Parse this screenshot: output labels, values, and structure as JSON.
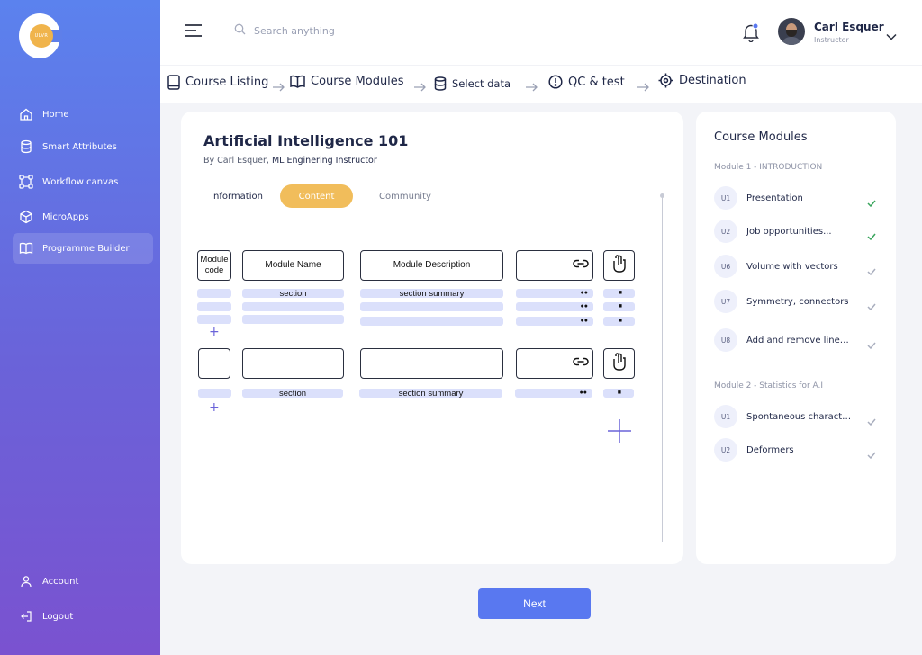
{
  "brand": {
    "logo_text": "ULVR"
  },
  "sidebar": {
    "items": [
      {
        "label": "Home",
        "icon": "home-icon"
      },
      {
        "label": "Smart Attributes",
        "icon": "database-icon"
      },
      {
        "label": "Workflow canvas",
        "icon": "workflow-icon"
      },
      {
        "label": "MicroApps",
        "icon": "cube-icon"
      },
      {
        "label": "Programme Builder",
        "icon": "book-icon",
        "active": true
      }
    ],
    "bottom": [
      {
        "label": "Account",
        "icon": "user-icon"
      },
      {
        "label": "Logout",
        "icon": "logout-icon"
      }
    ]
  },
  "header": {
    "search_placeholder": "Search anything",
    "user": {
      "name": "Carl Esquer",
      "role": "Instructor"
    },
    "notification_color": "#5978f0"
  },
  "steps": [
    {
      "label": "Course Listing",
      "icon": "tablet-icon"
    },
    {
      "label": "Course Modules",
      "icon": "open-book-icon"
    },
    {
      "label": "Select data",
      "icon": "database-icon"
    },
    {
      "label": "QC & test",
      "icon": "alert-circle-icon"
    },
    {
      "label": "Destination",
      "icon": "target-icon"
    }
  ],
  "course": {
    "title": "Artificial Intelligence 101",
    "by_prefix": "By Carl Esquer,",
    "by_role": "ML Enginering Instructor",
    "tabs": [
      {
        "label": "Information",
        "active": false
      },
      {
        "label": "Content",
        "active": true
      },
      {
        "label": "Community",
        "active": false
      }
    ]
  },
  "builder": {
    "columns": {
      "code": "Module code",
      "name": "Module Name",
      "description": "Module Description"
    },
    "section_label": "section",
    "summary_label": "section summary",
    "add_symbol": "+"
  },
  "modules_panel": {
    "title": "Course Modules",
    "modules": [
      {
        "heading": "Module 1 - INTRODUCTION",
        "lessons": [
          {
            "code": "U1",
            "title": "Presentation",
            "status": "done"
          },
          {
            "code": "U2",
            "title": "Job opportunities...",
            "status": "done"
          },
          {
            "code": "U6",
            "title": "Volume with vectors",
            "status": "pending"
          },
          {
            "code": "U7",
            "title": "Symmetry, connectors",
            "status": "pending"
          },
          {
            "code": "U8",
            "title": "Add and remove lines...",
            "status": "pending"
          }
        ]
      },
      {
        "heading": "Module 2 - Statistics for A.I",
        "lessons": [
          {
            "code": "U1",
            "title": "Spontaneous characters",
            "status": "pending"
          },
          {
            "code": "U2",
            "title": "Deformers",
            "status": "pending"
          }
        ]
      }
    ]
  },
  "actions": {
    "next_label": "Next"
  },
  "colors": {
    "accent": "#5978f0",
    "tab_active": "#f1bd5b",
    "done_check": "#3aa55d",
    "pending_check": "#a9aebe"
  }
}
